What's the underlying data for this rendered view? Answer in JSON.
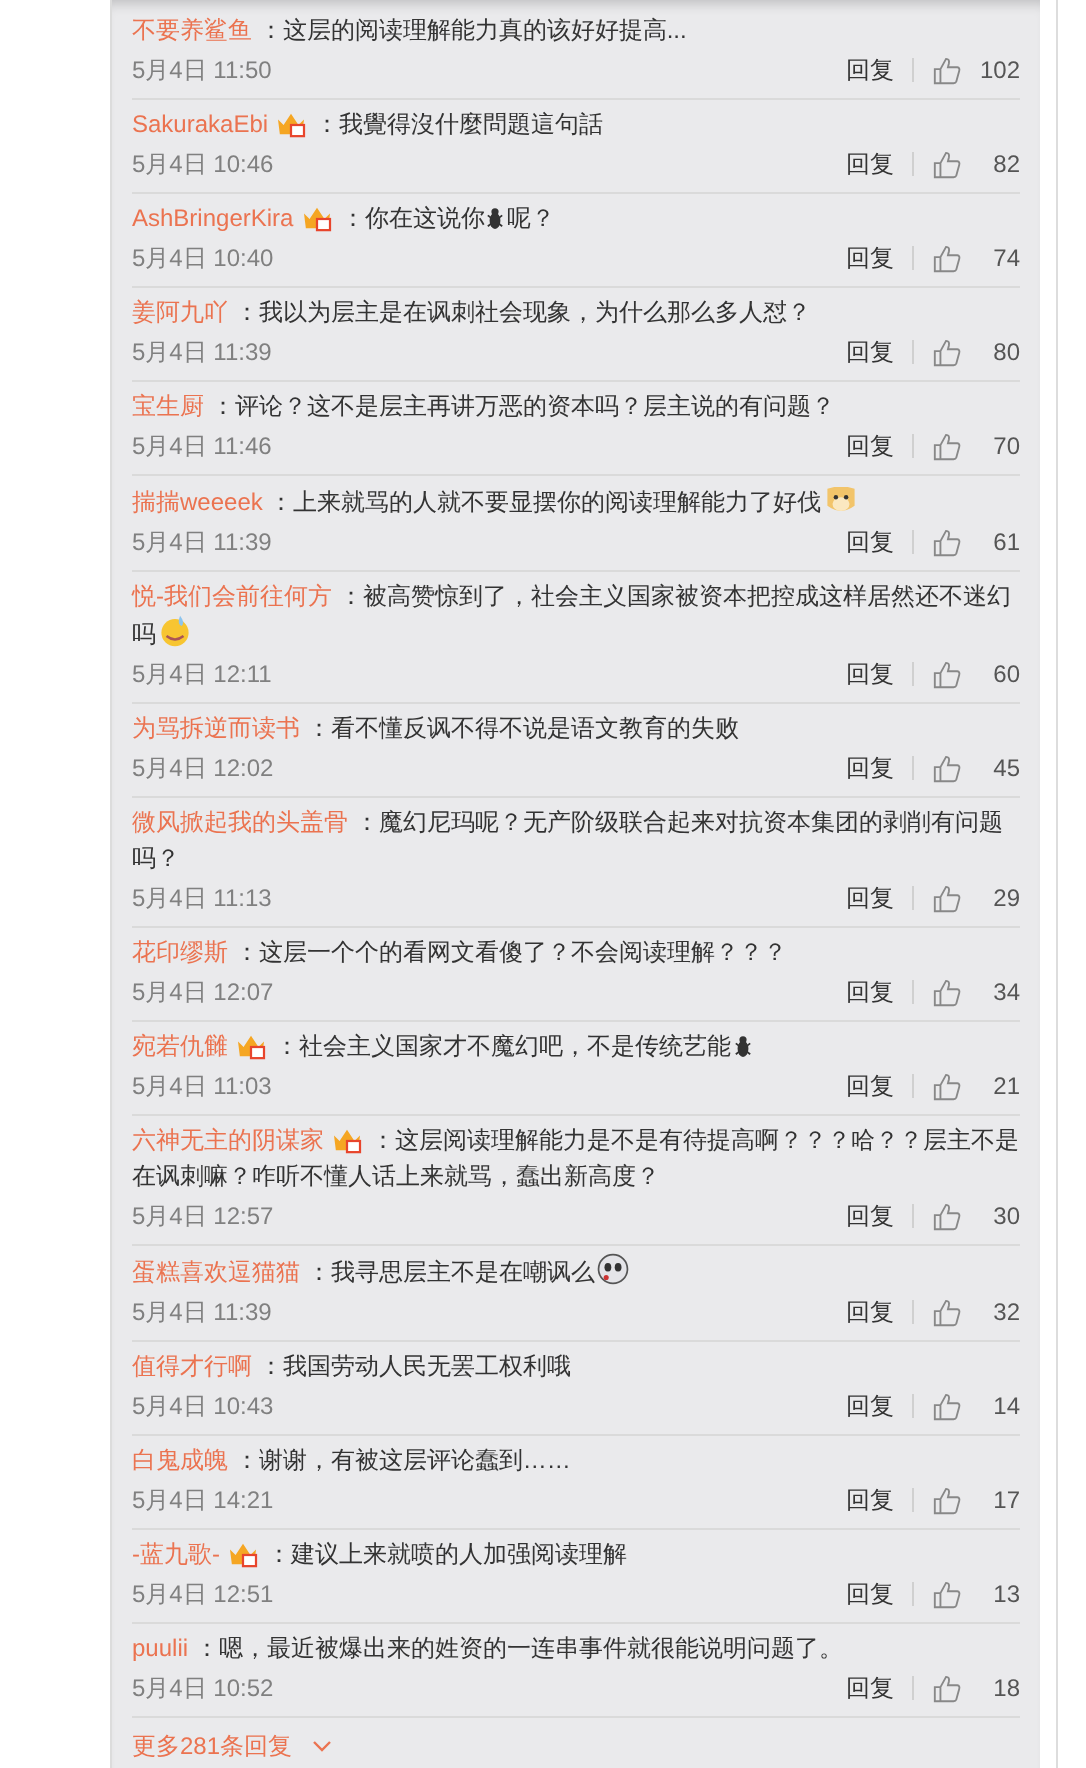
{
  "comments": [
    {
      "user": "不要养鲨鱼",
      "badge": false,
      "segments": [
        {
          "kind": "text",
          "text": "：这层的阅读理解能力真的该好好提高..."
        }
      ],
      "time": "5月4日 11:50",
      "reply": "回复",
      "likes": "102"
    },
    {
      "user": "SakurakaEbi",
      "badge": true,
      "segments": [
        {
          "kind": "text",
          "text": "：我覺得沒什麼問題這句話"
        }
      ],
      "time": "5月4日 10:46",
      "reply": "回复",
      "likes": "82"
    },
    {
      "user": "AshBringerKira",
      "badge": true,
      "segments": [
        {
          "kind": "text",
          "text": "：你在这说你"
        },
        {
          "kind": "bug"
        },
        {
          "kind": "text",
          "text": "呢？"
        }
      ],
      "time": "5月4日 10:40",
      "reply": "回复",
      "likes": "74"
    },
    {
      "user": "姜阿九吖",
      "badge": false,
      "segments": [
        {
          "kind": "text",
          "text": "：我以为层主是在讽刺社会现象，为什么那么多人怼？"
        }
      ],
      "time": "5月4日 11:39",
      "reply": "回复",
      "likes": "80"
    },
    {
      "user": "宝生厨",
      "badge": false,
      "segments": [
        {
          "kind": "text",
          "text": "：评论？这不是层主再讲万恶的资本吗？层主说的有问题？"
        }
      ],
      "time": "5月4日 11:46",
      "reply": "回复",
      "likes": "70"
    },
    {
      "user": "揣揣weeeek",
      "badge": false,
      "segments": [
        {
          "kind": "text",
          "text": "：上来就骂的人就不要显摆你的阅读理解能力了好伐"
        },
        {
          "kind": "dog"
        }
      ],
      "time": "5月4日 11:39",
      "reply": "回复",
      "likes": "61"
    },
    {
      "user": "悦-我们会前往何方",
      "badge": false,
      "segments": [
        {
          "kind": "text",
          "text": "：被高赞惊到了，社会主义国家被资本把控成这样居然还不迷幻吗"
        },
        {
          "kind": "sweat"
        }
      ],
      "time": "5月4日 12:11",
      "reply": "回复",
      "likes": "60"
    },
    {
      "user": "为骂拆逆而读书",
      "badge": false,
      "segments": [
        {
          "kind": "text",
          "text": "：看不懂反讽不得不说是语文教育的失败"
        }
      ],
      "time": "5月4日 12:02",
      "reply": "回复",
      "likes": "45"
    },
    {
      "user": "微风掀起我的头盖骨",
      "badge": false,
      "segments": [
        {
          "kind": "text",
          "text": "：魔幻尼玛呢？无产阶级联合起来对抗资本集团的剥削有问题吗？"
        }
      ],
      "time": "5月4日 11:13",
      "reply": "回复",
      "likes": "29"
    },
    {
      "user": "花印缪斯",
      "badge": false,
      "segments": [
        {
          "kind": "text",
          "text": "：这层一个个的看网文看傻了？不会阅读理解？？？"
        }
      ],
      "time": "5月4日 12:07",
      "reply": "回复",
      "likes": "34"
    },
    {
      "user": "宛若仇雠",
      "badge": true,
      "segments": [
        {
          "kind": "text",
          "text": "：社会主义国家才不魔幻吧，不是传统艺能"
        },
        {
          "kind": "bug"
        }
      ],
      "time": "5月4日 11:03",
      "reply": "回复",
      "likes": "21"
    },
    {
      "user": "六神无主的阴谋家",
      "badge": true,
      "segments": [
        {
          "kind": "text",
          "text": "：这层阅读理解能力是不是有待提高啊？？？哈？？层主不是在讽刺嘛？咋听不懂人话上来就骂，蠢出新高度？"
        }
      ],
      "time": "5月4日 12:57",
      "reply": "回复",
      "likes": "30"
    },
    {
      "user": "蛋糕喜欢逗猫猫",
      "badge": false,
      "segments": [
        {
          "kind": "text",
          "text": "：我寻思层主不是在嘲讽么"
        },
        {
          "kind": "panda"
        }
      ],
      "time": "5月4日 11:39",
      "reply": "回复",
      "likes": "32"
    },
    {
      "user": "值得才行啊",
      "badge": false,
      "segments": [
        {
          "kind": "text",
          "text": "：我国劳动人民无罢工权利哦"
        }
      ],
      "time": "5月4日 10:43",
      "reply": "回复",
      "likes": "14"
    },
    {
      "user": "白鬼成魄",
      "badge": false,
      "segments": [
        {
          "kind": "text",
          "text": "：谢谢，有被这层评论蠢到……"
        }
      ],
      "time": "5月4日 14:21",
      "reply": "回复",
      "likes": "17"
    },
    {
      "user": "-蓝九歌-",
      "badge": true,
      "segments": [
        {
          "kind": "text",
          "text": "：建议上来就喷的人加强阅读理解"
        }
      ],
      "time": "5月4日 12:51",
      "reply": "回复",
      "likes": "13"
    },
    {
      "user": "puulii",
      "badge": false,
      "segments": [
        {
          "kind": "text",
          "text": "：嗯，最近被爆出来的姓资的一连串事件就很能说明问题了。"
        }
      ],
      "time": "5月4日 10:52",
      "reply": "回复",
      "likes": "18"
    }
  ],
  "more": {
    "label": "更多281条回复"
  }
}
